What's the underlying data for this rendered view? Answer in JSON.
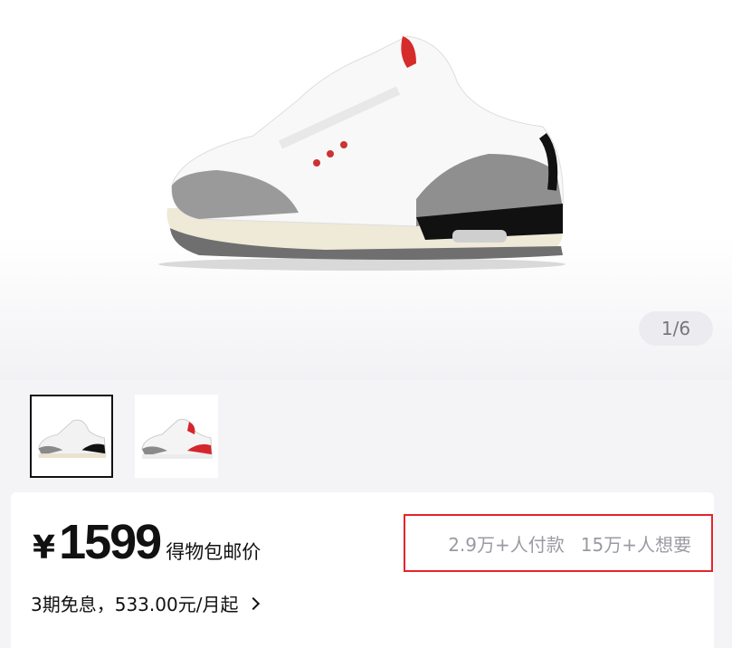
{
  "gallery": {
    "counter": "1/6",
    "hero_image": "sneaker-white-cement",
    "thumbnails": [
      {
        "icon": "sneaker-white-cement",
        "selected": true
      },
      {
        "icon": "sneaker-fire-red",
        "selected": false
      }
    ]
  },
  "product": {
    "currency": "¥",
    "price": "1599",
    "price_note": "得物包邮价",
    "paid_count": "2.9万+人付款",
    "want_count": "15万+人想要",
    "installment": "3期免息，533.00元/月起",
    "highlight_color": "#e5242b"
  }
}
